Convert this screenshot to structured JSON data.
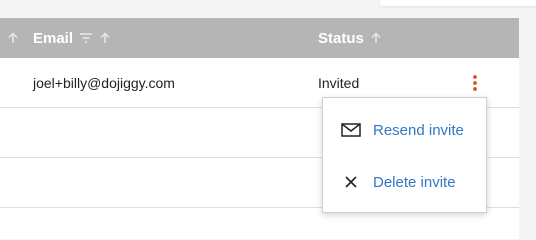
{
  "table": {
    "columns": [
      {
        "label": "Email",
        "sort_icon": "arrow-up-icon",
        "filter_icon": "filter-icon"
      },
      {
        "label": "Status",
        "sort_icon": "arrow-up-icon"
      }
    ],
    "rows": [
      {
        "email": "joel+billy@dojiggy.com",
        "status": "Invited",
        "actions_icon": "kebab-menu-icon"
      },
      {
        "email": "",
        "status": ""
      },
      {
        "email": "",
        "status": ""
      }
    ]
  },
  "context_menu": {
    "items": [
      {
        "label": "Resend invite",
        "icon": "envelope-icon"
      },
      {
        "label": "Delete invite",
        "icon": "close-icon"
      }
    ]
  },
  "colors": {
    "header_bg": "#b5b5b5",
    "header_text": "#ffffff",
    "link": "#2f78c4",
    "kebab": "#d8541e",
    "row_border": "#dedede"
  }
}
